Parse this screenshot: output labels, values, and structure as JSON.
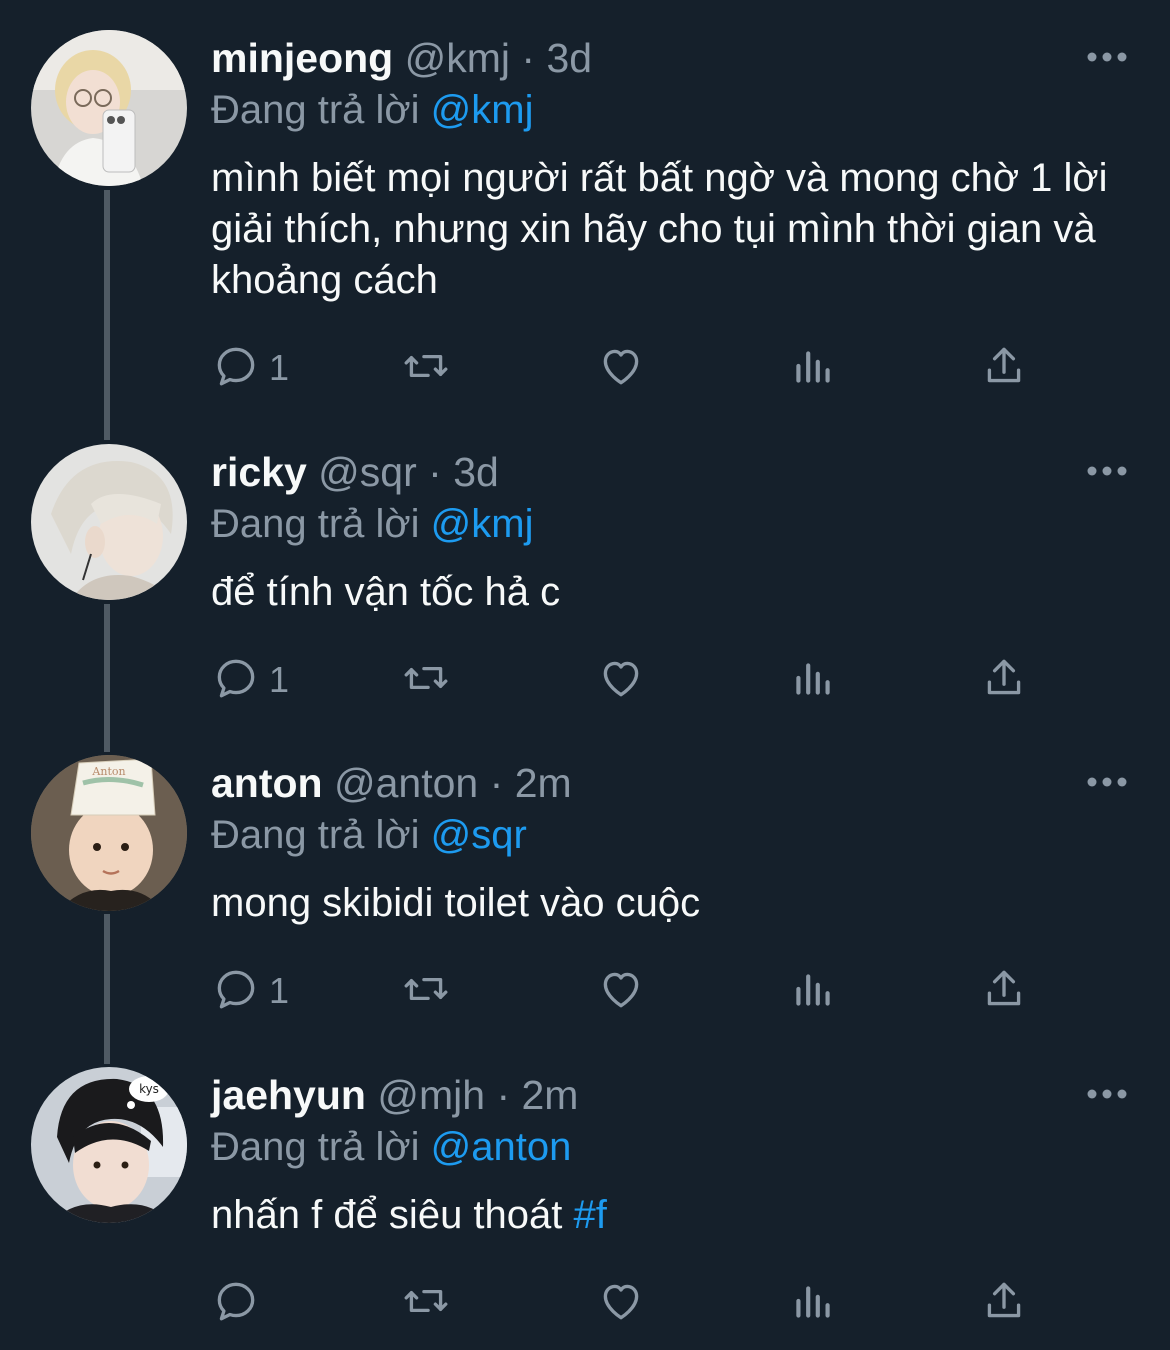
{
  "tweets": [
    {
      "name": "minjeong",
      "handle": "@kmj",
      "dot": "·",
      "time": "3d",
      "reply_prefix": "Đang trả lời",
      "reply_to": "@kmj",
      "text": "mình biết mọi người rất bất ngờ và mong chờ 1 lời giải thích, nhưng xin hãy cho tụi mình thời gian và khoảng cách",
      "hashtag": "",
      "reply_count": "1"
    },
    {
      "name": "ricky",
      "handle": "@sqr",
      "dot": "·",
      "time": "3d",
      "reply_prefix": "Đang trả lời",
      "reply_to": "@kmj",
      "text": "để tính vận tốc hả c",
      "hashtag": "",
      "reply_count": "1"
    },
    {
      "name": "anton",
      "handle": "@anton",
      "dot": "·",
      "time": "2m",
      "reply_prefix": "Đang trả lời",
      "reply_to": "@sqr",
      "text": "mong skibidi toilet vào cuộc",
      "hashtag": "",
      "reply_count": "1"
    },
    {
      "name": "jaehyun",
      "handle": "@mjh",
      "dot": "·",
      "time": "2m",
      "reply_prefix": "Đang trả lời",
      "reply_to": "@anton",
      "text": "nhấn f để siêu thoát ",
      "hashtag": "#f",
      "reply_count": ""
    }
  ],
  "avatar_stickers": {
    "anton_hat": "Anton",
    "jaehyun_bubble": "kys"
  },
  "icons": [
    "reply-icon",
    "retweet-icon",
    "like-icon",
    "views-icon",
    "share-icon",
    "more-icon"
  ],
  "colors": {
    "background": "#15202b",
    "text": "#f7f9f9",
    "muted": "#8b98a5",
    "accent": "#1d9bf0",
    "thread_line": "#4f5a64"
  }
}
